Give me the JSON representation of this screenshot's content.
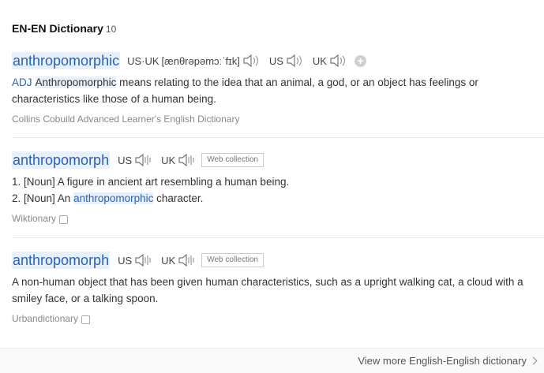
{
  "section": {
    "title": "EN-EN Dictionary",
    "count": "10"
  },
  "entries": [
    {
      "word": "anthropomorphic",
      "pron_label": "US·UK",
      "ipa": "[ænθrəpəmɔːˈfɪk]",
      "region1": "US",
      "region2": "UK",
      "pos": "ADJ",
      "def_highlight": "Anthropomorphic",
      "def_rest": " means relating to the idea that an animal, a god, or an object has feelings or characteristics like those of a human being.",
      "source": "Collins Cobuild Advanced Learner's English Dictionary"
    },
    {
      "word": "anthropomorph",
      "region1": "US",
      "region2": "UK",
      "tag": "Web collection",
      "line1": "1. [Noun] A figure in ancient art resembling a human being.",
      "line2_pre": "2. [Noun] An ",
      "line2_hl": "anthropomorphic",
      "line2_post": " character.",
      "source": "Wiktionary"
    },
    {
      "word": "anthropomorph",
      "region1": "US",
      "region2": "UK",
      "tag": "Web collection",
      "def": "A non-human object that has been given human characteristics, such as a upright walking cat, a cloud with a smiley face, or a talking spoon.",
      "source": "Urbandictionary"
    }
  ],
  "footer": {
    "more_label": "View more English-English dictionary"
  },
  "icons": {
    "speaker": "speaker-icon",
    "plus": "add-icon",
    "copy": "copy-icon",
    "chevron": "chevron-right-icon"
  }
}
